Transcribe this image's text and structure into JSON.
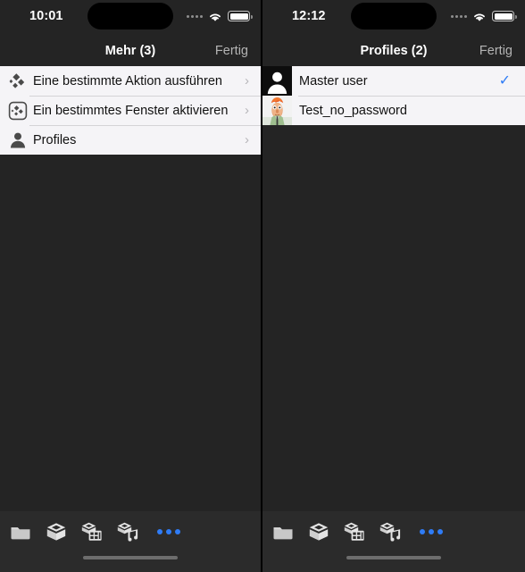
{
  "panels": [
    {
      "id": "more-menu",
      "status": {
        "time": "10:01",
        "signal_icon": "cellular-signal-icon",
        "wifi_icon": "wifi-icon",
        "battery_icon": "battery-icon"
      },
      "nav": {
        "title": "Mehr (3)",
        "done_label": "Fertig"
      },
      "rows": [
        {
          "icon": "kodi-logo-icon",
          "label": "Eine bestimmte Aktion ausführen",
          "accessory": "›"
        },
        {
          "icon": "kodi-window-icon",
          "label": "Ein bestimmtes Fenster aktivieren",
          "accessory": "›"
        },
        {
          "icon": "person-icon",
          "label": "Profiles",
          "accessory": "›"
        }
      ]
    },
    {
      "id": "profiles-list",
      "status": {
        "time": "12:12",
        "signal_icon": "cellular-signal-icon",
        "wifi_icon": "wifi-icon",
        "battery_icon": "battery-icon"
      },
      "nav": {
        "title": "Profiles (2)",
        "done_label": "Fertig"
      },
      "profiles": [
        {
          "avatar": "default-user-avatar",
          "name": "Master user",
          "selected": true,
          "check": "✓"
        },
        {
          "avatar": "beaker-character-avatar",
          "name": "Test_no_password",
          "selected": false,
          "check": ""
        }
      ]
    }
  ],
  "toolbar": {
    "items": [
      {
        "icon": "files-folder-icon",
        "label": "Files"
      },
      {
        "icon": "kodi-box-icon",
        "label": "Library"
      },
      {
        "icon": "movies-icon",
        "label": "Movies"
      },
      {
        "icon": "music-icon",
        "label": "Music"
      }
    ],
    "more_icon": "more-dots-icon",
    "more_label": "More"
  },
  "colors": {
    "background_dark": "#242424",
    "toolbar_dark": "#2b2b2b",
    "list_background": "#f5f4f7",
    "accent_blue": "#2f7cf6",
    "nav_done_gray": "#b4b4b4",
    "separator": "#d4d3d6"
  }
}
